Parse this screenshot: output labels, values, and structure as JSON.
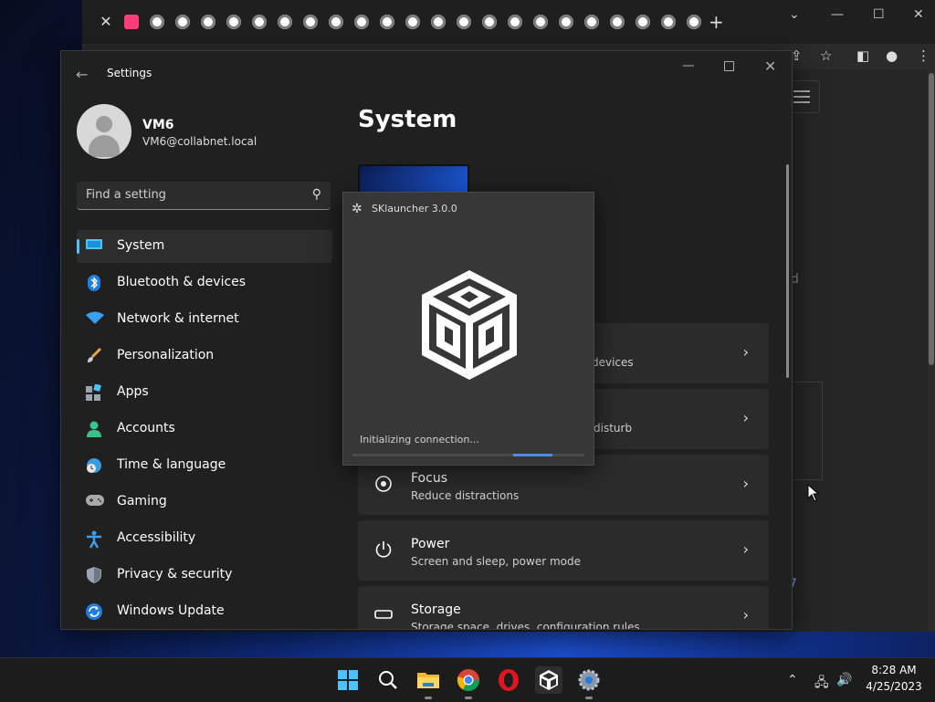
{
  "settings": {
    "window_title": "Settings",
    "profile": {
      "name": "VM6",
      "email": "VM6@collabnet.local"
    },
    "search": {
      "placeholder": "Find a setting"
    },
    "nav": [
      {
        "label": "System",
        "icon": "monitor-icon",
        "active": true
      },
      {
        "label": "Bluetooth & devices",
        "icon": "bluetooth-icon"
      },
      {
        "label": "Network & internet",
        "icon": "wifi-icon"
      },
      {
        "label": "Personalization",
        "icon": "brush-icon"
      },
      {
        "label": "Apps",
        "icon": "apps-icon"
      },
      {
        "label": "Accounts",
        "icon": "person-icon"
      },
      {
        "label": "Time & language",
        "icon": "globe-clock-icon"
      },
      {
        "label": "Gaming",
        "icon": "gamepad-icon"
      },
      {
        "label": "Accessibility",
        "icon": "accessibility-icon"
      },
      {
        "label": "Privacy & security",
        "icon": "shield-icon"
      },
      {
        "label": "Windows Update",
        "icon": "update-icon"
      }
    ],
    "page_title": "System",
    "cards": [
      {
        "title": "",
        "sub": "devices"
      },
      {
        "title": "",
        "sub": "disturb"
      },
      {
        "title": "Focus",
        "sub": "Reduce distractions",
        "icon": "focus-icon"
      },
      {
        "title": "Power",
        "sub": "Screen and sleep, power mode",
        "icon": "power-icon"
      },
      {
        "title": "Storage",
        "sub": "Storage space, drives, configuration rules",
        "icon": "storage-icon"
      }
    ]
  },
  "sklauncher": {
    "title": "SKlauncher 3.0.0",
    "status": "Initializing connection...",
    "progress": 0.17
  },
  "chrome_background": {
    "side_text": "d",
    "link_text": "7"
  },
  "taskbar": {
    "apps": [
      "windows-start-icon",
      "search-icon",
      "file-explorer-icon",
      "chrome-icon",
      "opera-icon",
      "sklauncher-icon",
      "settings-icon"
    ],
    "time": "8:28 AM",
    "date": "4/25/2023"
  },
  "colors": {
    "accent": "#4cc2ff",
    "progress": "#4d8de8",
    "window_bg": "#202020"
  }
}
